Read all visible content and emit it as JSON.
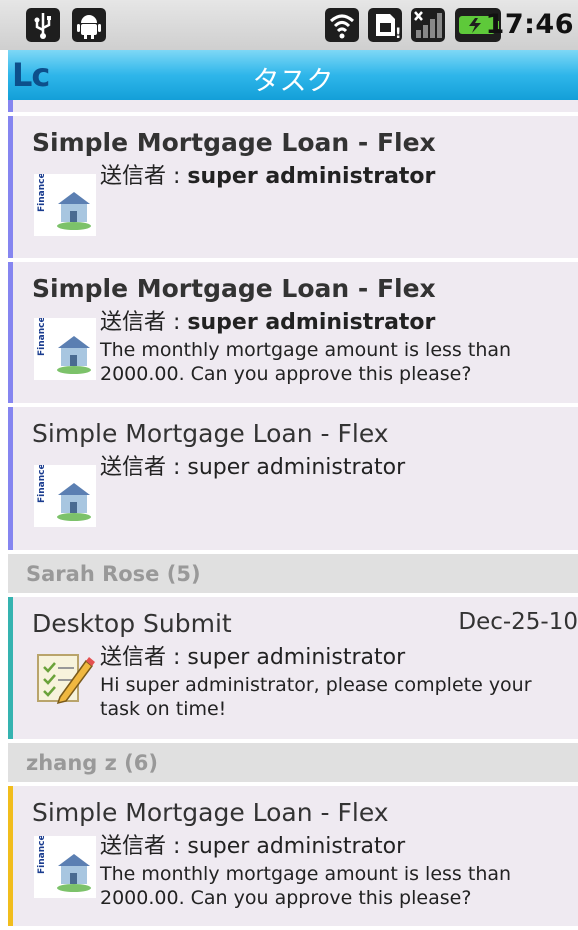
{
  "status_bar": {
    "icons": [
      "usb-icon",
      "android-icon",
      "wifi-icon",
      "sim-icon",
      "signal-icon",
      "battery-icon"
    ],
    "time": "17:46"
  },
  "title_bar": {
    "logo": "Lc",
    "title": "タスク"
  },
  "tasks_top": [
    {
      "title": "Simple Mortgage Loan - Flex",
      "sender_label": "送信者 : ",
      "sender": "super administrator",
      "description": "",
      "unread": true
    },
    {
      "title": "Simple Mortgage Loan - Flex",
      "sender_label": "送信者 : ",
      "sender": "super administrator",
      "description_line1": "The monthly mortgage amount is less than",
      "description_line2": "2000.00. Can you approve this please?",
      "unread": true
    },
    {
      "title": "Simple Mortgage Loan - Flex",
      "sender_label": "送信者 : ",
      "sender": "super administrator",
      "description": "",
      "unread": false
    }
  ],
  "groups": [
    {
      "header": "Sarah Rose (5)",
      "task": {
        "title": "Desktop Submit",
        "date": "Dec-25-10",
        "sender_label": "送信者 : ",
        "sender": "super administrator",
        "description_line1": "Hi super administrator, please complete your",
        "description_line2": "task on time!"
      }
    },
    {
      "header": "zhang z (6)",
      "task": {
        "title": "Simple Mortgage Loan - Flex",
        "sender_label": "送信者 : ",
        "sender": "super administrator",
        "description_line1": "The monthly mortgage amount is less than",
        "description_line2": "2000.00. Can you approve this please?"
      }
    }
  ],
  "thumbnail_text": "Finance",
  "colors": {
    "accent_blue": "#8585f0",
    "accent_teal": "#35b3b0",
    "accent_yellow": "#f1bd1c",
    "title_bar": "#2fb6ea"
  }
}
